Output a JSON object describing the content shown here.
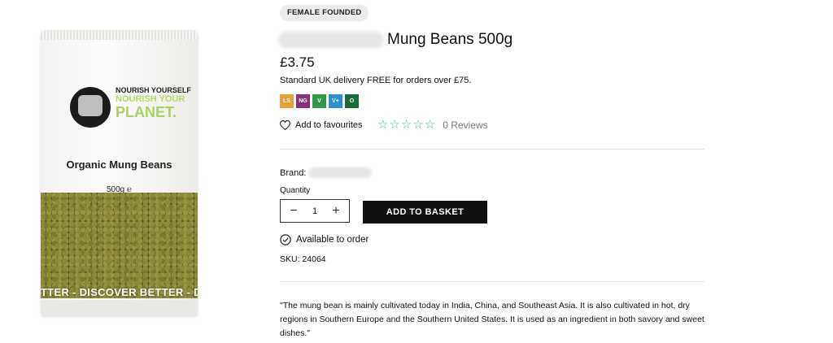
{
  "product_image": {
    "logo_line1": "NOURISH YOURSELF",
    "logo_line2": "NOURISH YOUR",
    "logo_line3": "PLANET.",
    "bag_title": "Organic Mung Beans",
    "bag_weight": "500g ℮",
    "bag_band": "TTER - DISCOVER BETTER - DISC"
  },
  "tag": "FEMALE FOUNDED",
  "product": {
    "title": "Mung Beans 500g",
    "price": "£3.75",
    "delivery": "Standard UK delivery FREE for orders over £75."
  },
  "diet_badges": [
    {
      "code": "LS",
      "color": "#e8a13a"
    },
    {
      "code": "NG",
      "color": "#8a2f7a"
    },
    {
      "code": "V",
      "color": "#2d9a49"
    },
    {
      "code": "V+",
      "color": "#2d8fcf"
    },
    {
      "code": "O",
      "color": "#1b6b3a"
    }
  ],
  "favourites": {
    "label": "Add to favourites",
    "icon": "heart-outline-icon"
  },
  "rating": {
    "stars": 0,
    "max": 5,
    "reviews_label": "0 Reviews",
    "star_color": "#47c08a"
  },
  "brand": {
    "label": "Brand:"
  },
  "quantity": {
    "label": "Quantity",
    "value": "1",
    "minus": "−",
    "plus": "+"
  },
  "basket_button": "ADD TO BASKET",
  "availability": {
    "text": "Available to order",
    "icon": "check-circle-icon"
  },
  "sku": "SKU: 24064",
  "description": "\"The mung bean is mainly cultivated today in India, China, and Southeast Asia. It is also cultivated in hot, dry regions in Southern Europe and the Southern United States. It is used as an ingredient in both savory and sweet dishes.\""
}
